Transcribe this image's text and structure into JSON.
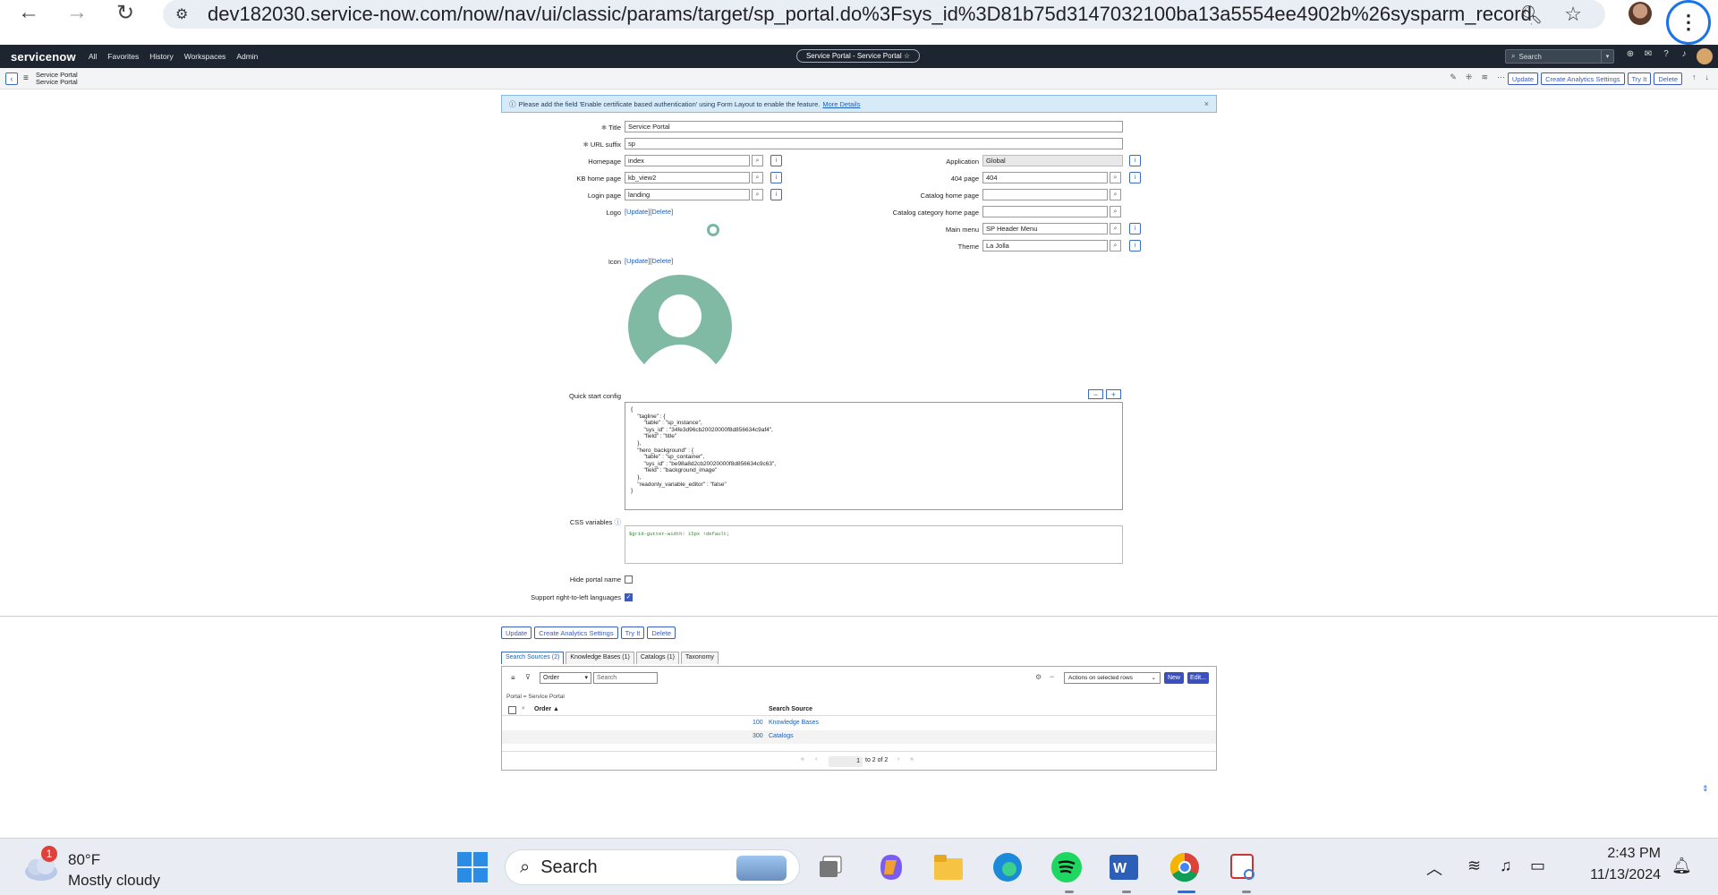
{
  "browser": {
    "url": "dev182030.service-now.com/now/nav/ui/classic/params/target/sp_portal.do%3Fsys_id%3D81b75d3147032100ba13a5554ee4902b%26sysparm_record_tar..."
  },
  "sn_header": {
    "logo": "servicenow",
    "menu": [
      "All",
      "Favorites",
      "History",
      "Workspaces",
      "Admin"
    ],
    "context_pill": "Service Portal - Service Portal ☆",
    "search_placeholder": "Search"
  },
  "form_header": {
    "breadcrumb_line1": "Service Portal",
    "breadcrumb_line2": "Service Portal",
    "buttons": [
      "Update",
      "Create Analytics Settings",
      "Try It",
      "Delete"
    ]
  },
  "banner": {
    "text": "Please add the field 'Enable certificate based authentication' using Form Layout to enable the feature.",
    "link": "More Details"
  },
  "form": {
    "title_label": "Title",
    "title_value": "Service Portal",
    "url_label": "URL suffix",
    "url_value": "sp",
    "homepage_label": "Homepage",
    "homepage_value": "index",
    "kb_label": "KB home page",
    "kb_value": "kb_view2",
    "login_label": "Login page",
    "login_value": "landing",
    "logo_label": "Logo",
    "logo_links": "[Update][Delete]",
    "icon_label": "Icon",
    "icon_links": "[Update][Delete]",
    "application_label": "Application",
    "application_value": "Global",
    "p404_label": "404 page",
    "p404_value": "404",
    "catalog_label": "Catalog home page",
    "catalog_value": "",
    "catcat_label": "Catalog category home page",
    "catcat_value": "",
    "mainmenu_label": "Main menu",
    "mainmenu_value": "SP Header Menu",
    "theme_label": "Theme",
    "theme_value": "La Jolla",
    "quickstart_label": "Quick start config",
    "quickstart_text": "{\n    \"tagline\" : {\n        \"table\" : \"sp_instance\",\n        \"sys_id\" : \"34fe3d96cb20020000f8d856634c9af4\",\n        \"field\" : \"title\"\n    },\n    \"hero_background\" : {\n        \"table\" : \"sp_container\",\n        \"sys_id\" : \"be98a8d2cb20020000f8d856634c9c63\",\n        \"field\" : \"background_image\"\n    },\n    \"readonly_variable_editor\" : \"false\"\n}",
    "css_label": "CSS variables",
    "css_value": "$grid-gutter-width: 15px !default;",
    "hide_label": "Hide portal name",
    "hide_checked": false,
    "rtl_label": "Support right-to-left languages",
    "rtl_checked": true
  },
  "bottom_buttons": [
    "Update",
    "Create Analytics Settings",
    "Try It",
    "Delete"
  ],
  "related": {
    "tabs": [
      "Search Sources (2)",
      "Knowledge Bases (1)",
      "Catalogs (1)",
      "Taxonomy"
    ],
    "filter_select": "Order",
    "search_placeholder": "Search",
    "actions": "Actions on selected rows",
    "new_label": "New",
    "edit_label": "Edit...",
    "breadcrumb": "Portal = Service Portal",
    "columns": [
      "Order ▲",
      "Search Source"
    ],
    "rows": [
      {
        "order": "100",
        "source": "Knowledge Bases"
      },
      {
        "order": "300",
        "source": "Catalogs"
      }
    ],
    "pager_value": "1",
    "pager_text": "to 2 of 2"
  },
  "taskbar": {
    "badge": "1",
    "temp": "80°F",
    "weather": "Mostly cloudy",
    "search": "Search",
    "time": "2:43 PM",
    "date": "11/13/2024"
  }
}
